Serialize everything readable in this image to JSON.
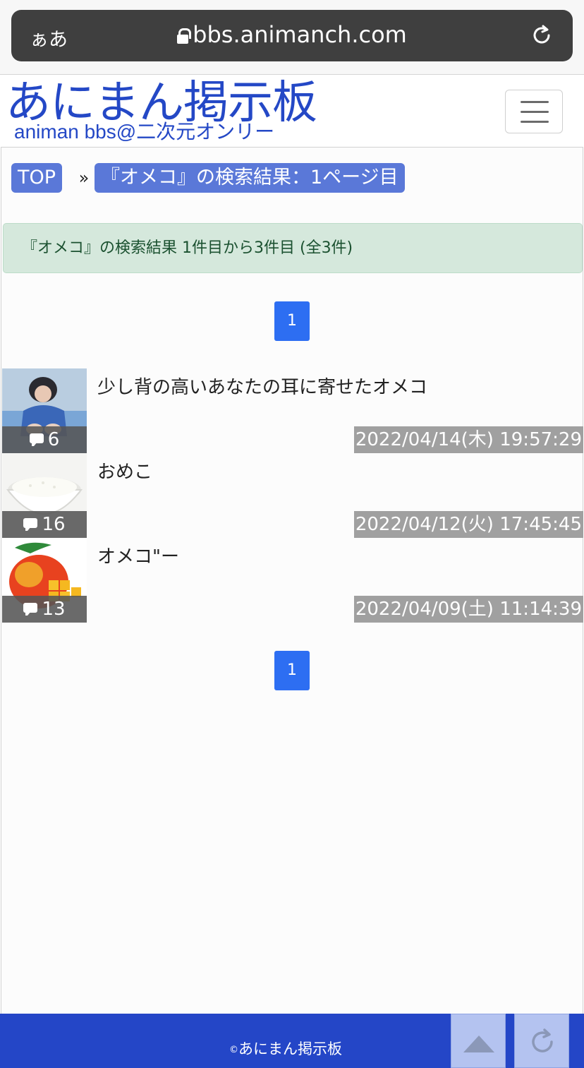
{
  "browser": {
    "text_size_label": "ぁあ",
    "url": "bbs.animanch.com"
  },
  "header": {
    "logo_title": "あにまん掲示板",
    "logo_subtitle": "animan bbs@二次元オンリー"
  },
  "breadcrumb": {
    "top_label": "TOP",
    "separator": "»",
    "current_label": "『オメコ』の検索結果：1ページ目"
  },
  "search": {
    "summary": "『オメコ』の検索結果 1件目から3件目 (全3件)"
  },
  "pagination": {
    "top_page": "1",
    "bottom_page": "1"
  },
  "threads": [
    {
      "title": "少し背の高いあなたの耳に寄せたオメコ",
      "comment_count": "6",
      "date": "2022/04/14(木) 19:57:29",
      "thumbnail": "girl-photo"
    },
    {
      "title": "おめこ",
      "comment_count": "16",
      "date": "2022/04/12(火) 17:45:45",
      "thumbnail": "rice-bowl-photo"
    },
    {
      "title": "オメコ\"ー",
      "comment_count": "13",
      "date": "2022/04/09(土) 11:14:39",
      "thumbnail": "mango-photo"
    }
  ],
  "footer": {
    "copyright_symbol": "©",
    "copyright_text": "あにまん掲示板"
  },
  "colors": {
    "brand_blue": "#2448c6",
    "breadcrumb_blue": "#5a78d8",
    "pager_blue": "#2d6ef2",
    "alert_green_bg": "#d5e8dc",
    "footer_blue": "#2446c7"
  }
}
